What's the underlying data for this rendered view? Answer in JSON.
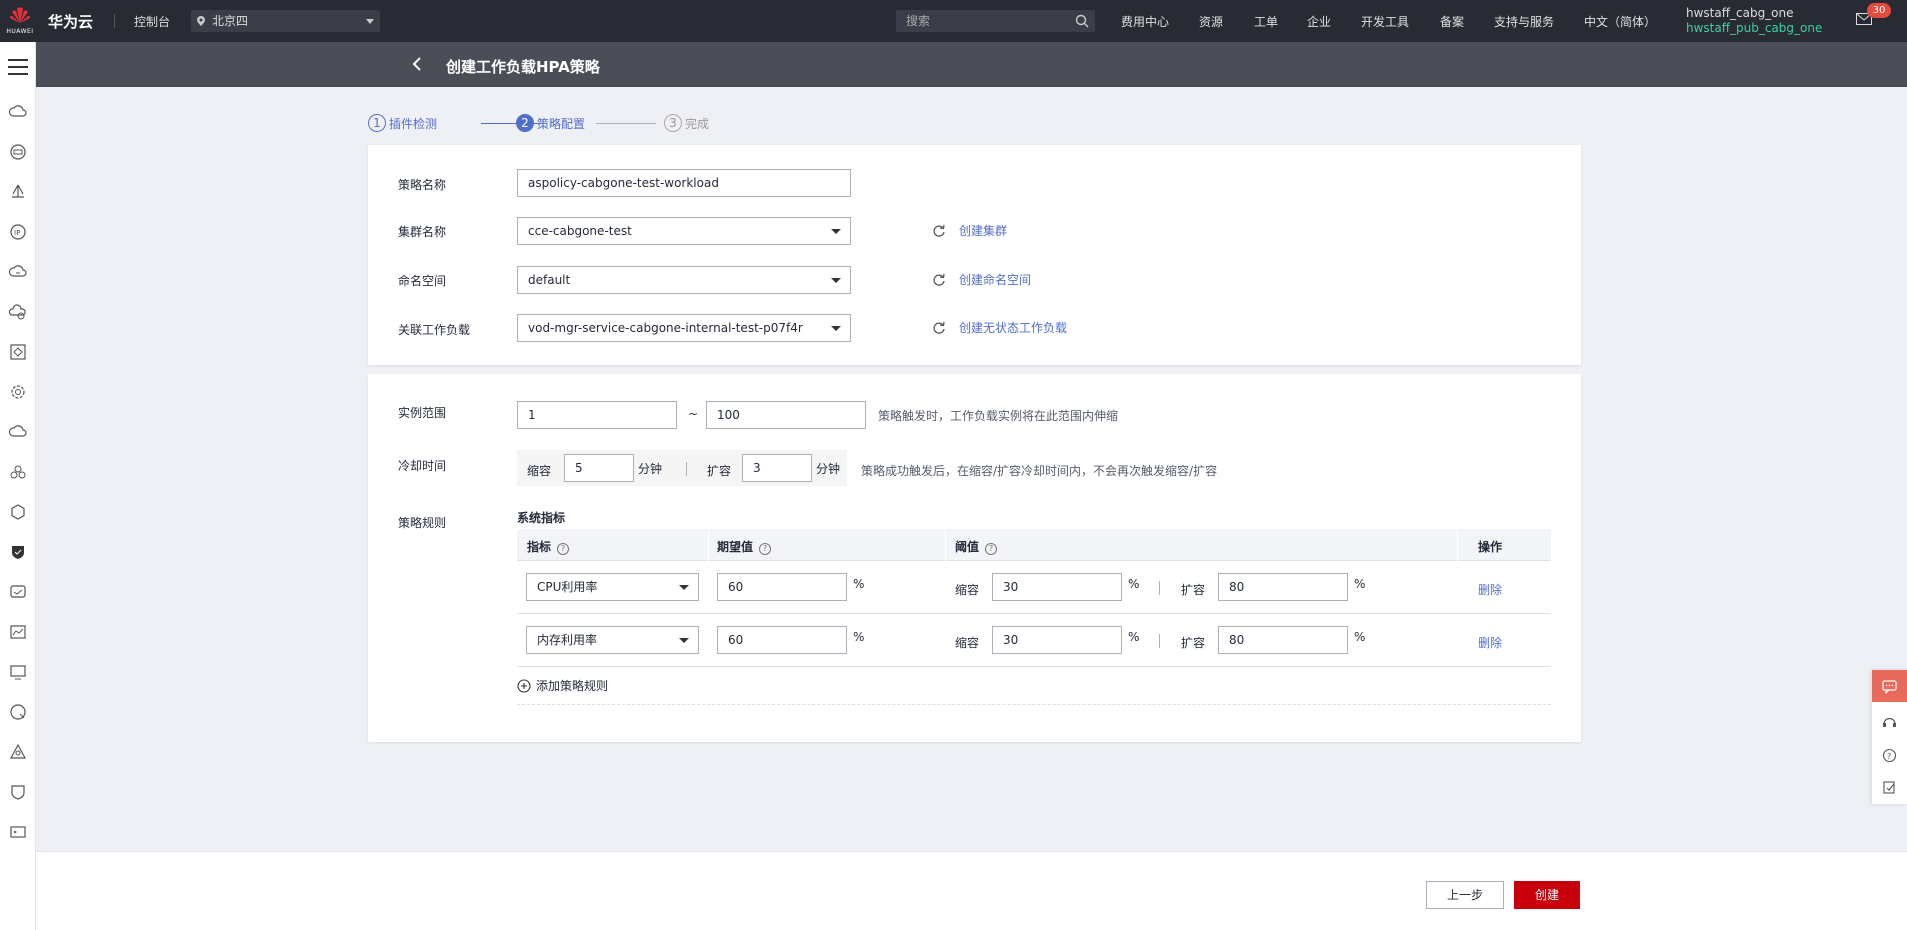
{
  "topbar": {
    "logo_text": "HUAWEI",
    "brand": "华为云",
    "console": "控制台",
    "region": "北京四",
    "search_placeholder": "搜索",
    "nav": [
      "费用中心",
      "资源",
      "工单",
      "企业",
      "开发工具",
      "备案",
      "支持与服务",
      "中文（简体）"
    ],
    "user_name": "hwstaff_cabg_one",
    "user_sub": "hwstaff_pub_cabg_one",
    "mail_count": "30"
  },
  "sidebar": {
    "icons": [
      "cloud-icon",
      "ecs-icon",
      "deploy-icon",
      "ip-icon",
      "cloud-sync-icon",
      "hybrid-cloud-icon",
      "network-icon",
      "settings-cog-icon",
      "cloud-service-icon",
      "cluster-icon",
      "container-icon",
      "security-shield-icon",
      "monitor-icon",
      "analytics-icon",
      "screen-icon",
      "search-circle-icon",
      "topology-icon",
      "badge-shield-icon",
      "terminal-icon"
    ]
  },
  "header": {
    "title": "创建工作负载HPA策略"
  },
  "steps": [
    {
      "num": "1",
      "label": "插件检测",
      "state": "done"
    },
    {
      "num": "2",
      "label": "策略配置",
      "state": "active"
    },
    {
      "num": "3",
      "label": "完成",
      "state": "todo"
    }
  ],
  "basic": {
    "policy_name_label": "策略名称",
    "policy_name_value": "aspolicy-cabgone-test-workload",
    "cluster_label": "集群名称",
    "cluster_value": "cce-cabgone-test",
    "cluster_link": "创建集群",
    "namespace_label": "命名空间",
    "namespace_value": "default",
    "namespace_link": "创建命名空间",
    "workload_label": "关联工作负载",
    "workload_value": "vod-mgr-service-cabgone-internal-test-p07f4r",
    "workload_link": "创建无状态工作负载"
  },
  "scaling": {
    "range_label": "实例范围",
    "range_min": "1",
    "range_sep": "~",
    "range_max": "100",
    "range_hint": "策略触发时，工作负载实例将在此范围内伸缩",
    "cooldown_label": "冷却时间",
    "scale_in_label": "缩容",
    "scale_in_value": "5",
    "scale_in_unit": "分钟",
    "scale_out_label": "扩容",
    "scale_out_value": "3",
    "scale_out_unit": "分钟",
    "cooldown_hint": "策略成功触发后，在缩容/扩容冷却时间内，不会再次触发缩容/扩容",
    "rules_label": "策略规则",
    "system_metrics_title": "系统指标",
    "columns": [
      "指标",
      "期望值",
      "阈值",
      "操作"
    ],
    "rows": [
      {
        "metric": "CPU利用率",
        "expected": "60",
        "unit": "%",
        "in_label": "缩容",
        "in_value": "30",
        "out_label": "扩容",
        "out_value": "80",
        "action": "删除"
      },
      {
        "metric": "内存利用率",
        "expected": "60",
        "unit": "%",
        "in_label": "缩容",
        "in_value": "30",
        "out_label": "扩容",
        "out_value": "80",
        "action": "删除"
      }
    ],
    "add_rule": "添加策略规则"
  },
  "footer": {
    "prev": "上一步",
    "create": "创建"
  },
  "colors": {
    "primary": "#526ecc",
    "danger": "#c7000b",
    "topbar": "#282b33",
    "subheader": "#4b4e57",
    "user_sub": "#3bd0a0"
  }
}
